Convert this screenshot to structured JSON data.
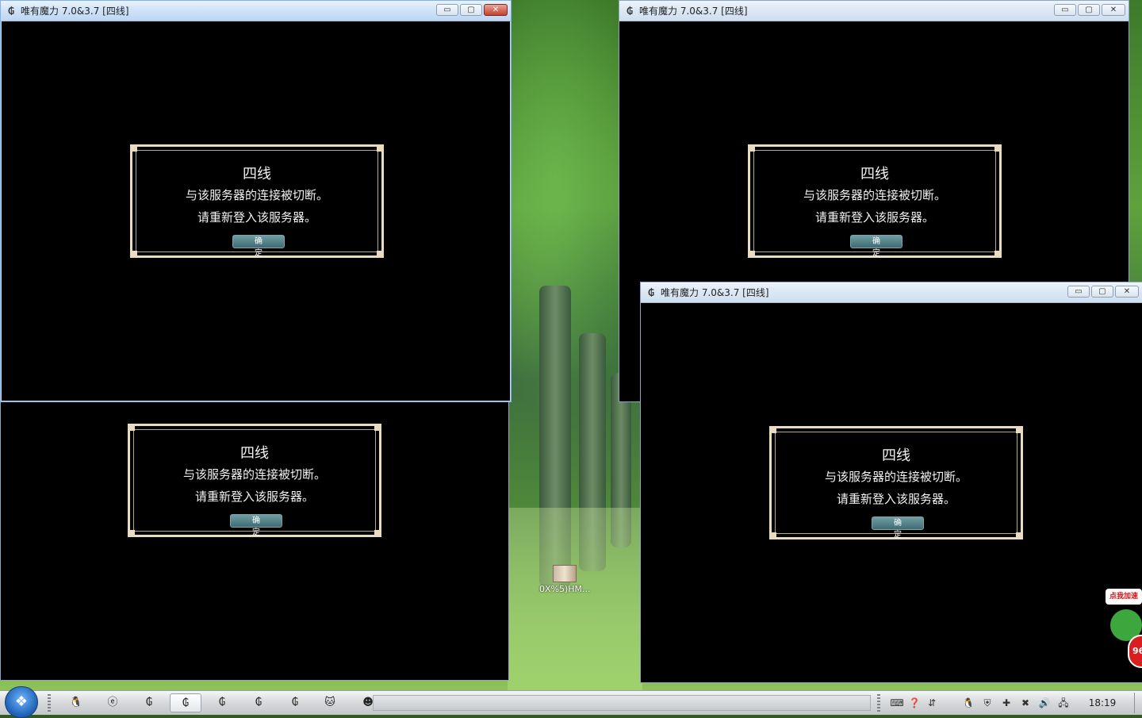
{
  "windows": [
    {
      "title": "唯有魔力 7.0&3.7 [四线]",
      "active": true
    },
    {
      "title": "唯有魔力 7.0&3.7 [四线]",
      "active": false
    },
    {
      "title": "唯有魔力 7.0&3.7 [四线]",
      "active": false
    }
  ],
  "window_controls": {
    "minimize": "▭",
    "maximize": "▢",
    "close": "✕"
  },
  "dialog": {
    "title": "四线",
    "line1": "与该服务器的连接被切断。",
    "line2": "请重新登入该服务器。",
    "ok_label": "确定"
  },
  "desktop_icon": {
    "label": "0X%5)HM..."
  },
  "floating_widget": {
    "badge": "点我加速",
    "number": "96"
  },
  "taskbar": {
    "start_icon": "windows-orb",
    "clock": "18:19"
  }
}
